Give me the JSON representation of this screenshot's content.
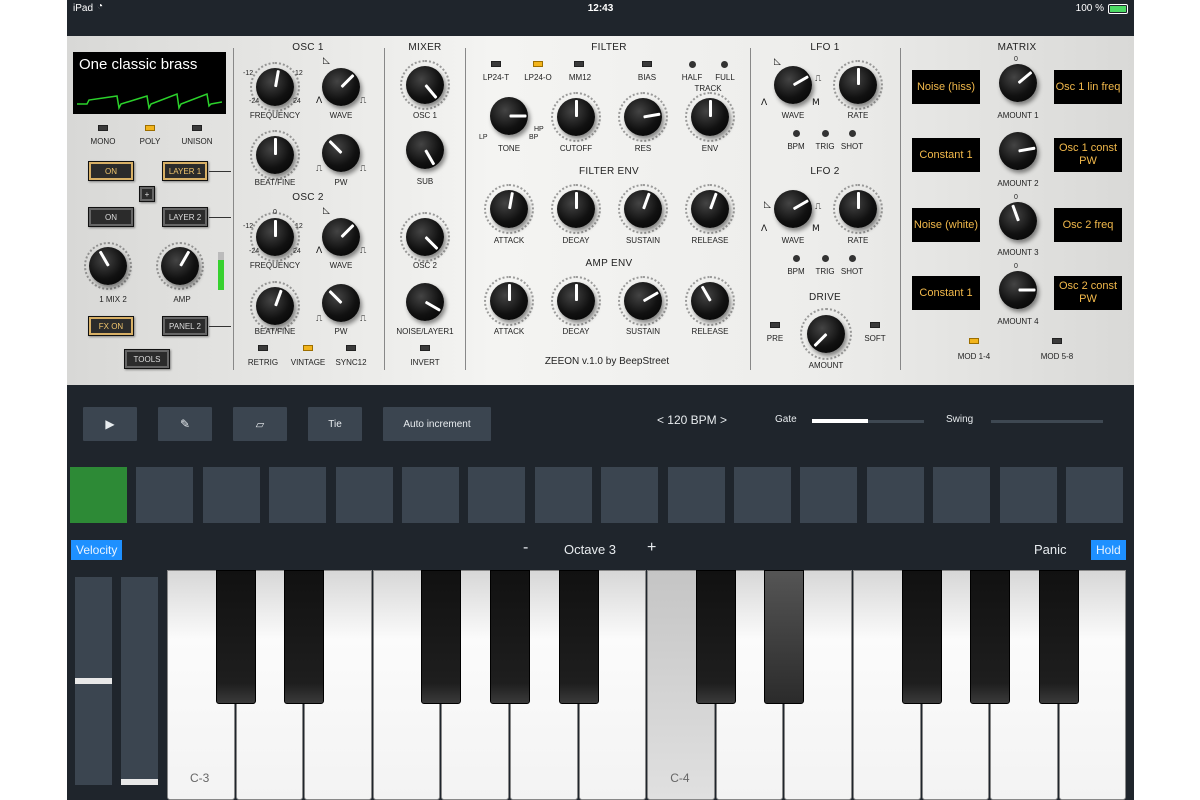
{
  "status": {
    "device": "iPad",
    "time": "12:43",
    "battery": "100 %"
  },
  "synth": {
    "display": {
      "preset_name": "One classic brass"
    },
    "voice_modes": [
      "MONO",
      "POLY",
      "UNISON"
    ],
    "layer_buttons": {
      "on1": "ON",
      "layer1": "LAYER 1",
      "plus": "+",
      "on2": "ON",
      "layer2": "LAYER 2",
      "fx_on": "FX ON",
      "panel2": "PANEL 2",
      "tools": "TOOLS"
    },
    "master": {
      "mix": "1 MIX 2",
      "amp": "AMP"
    },
    "osc1": {
      "title": "OSC 1",
      "freq_min": "-12",
      "freq_max": "12",
      "freq_min2": "-24",
      "freq_max2": "24",
      "frequency": "FREQUENCY",
      "wave": "WAVE",
      "beat": "BEAT/FINE",
      "pw": "PW"
    },
    "osc2": {
      "title": "OSC 2",
      "freq_min": "-12",
      "freq_max": "12",
      "freq_min2": "-24",
      "freq_max2": "24",
      "zero": "0",
      "frequency": "FREQUENCY",
      "wave": "WAVE",
      "beat": "BEAT/FINE",
      "pw": "PW"
    },
    "osc_switches": [
      "RETRIG",
      "VINTAGE",
      "SYNC12"
    ],
    "mixer": {
      "title": "MIXER",
      "osc1": "OSC 1",
      "sub": "SUB",
      "osc2": "OSC 2",
      "noise": "NOISE/LAYER1",
      "invert": "INVERT"
    },
    "filter": {
      "title": "FILTER",
      "modes": [
        "LP24-T",
        "LP24-O",
        "MM12"
      ],
      "bias": "BIAS",
      "half": "HALF",
      "full": "FULL",
      "track": "TRACK",
      "tone": "TONE",
      "cutoff": "CUTOFF",
      "res": "RES",
      "env": "ENV",
      "lp": "LP",
      "hp": "HP",
      "bp": "BP"
    },
    "filter_env": {
      "title": "FILTER ENV",
      "attack": "ATTACK",
      "decay": "DECAY",
      "sustain": "SUSTAIN",
      "release": "RELEASE"
    },
    "amp_env": {
      "title": "AMP ENV",
      "attack": "ATTACK",
      "decay": "DECAY",
      "sustain": "SUSTAIN",
      "release": "RELEASE"
    },
    "brand": "ZEEON v.1.0  by BeepStreet",
    "lfo1": {
      "title": "LFO 1",
      "wave": "WAVE",
      "rate": "RATE",
      "modes": [
        "BPM",
        "TRIG",
        "SHOT"
      ]
    },
    "lfo2": {
      "title": "LFO 2",
      "wave": "WAVE",
      "rate": "RATE",
      "modes": [
        "BPM",
        "TRIG",
        "SHOT"
      ]
    },
    "drive": {
      "title": "DRIVE",
      "pre": "PRE",
      "soft": "SOFT",
      "amount": "AMOUNT"
    },
    "matrix": {
      "title": "MATRIX",
      "rows": [
        {
          "source": "Noise (hiss)",
          "amount": "AMOUNT 1",
          "dest": "Osc 1 lin freq"
        },
        {
          "source": "Constant 1",
          "amount": "AMOUNT 2",
          "dest": "Osc 1 const PW"
        },
        {
          "source": "Noise (white)",
          "amount": "AMOUNT 3",
          "dest": "Osc 2 freq"
        },
        {
          "source": "Constant 1",
          "amount": "AMOUNT 4",
          "dest": "Osc 2 const PW"
        }
      ],
      "zero": "0",
      "pages": [
        "MOD 1-4",
        "MOD 5-8"
      ]
    },
    "colors": {
      "led_on": "#f2b41c",
      "mod_text": "#f2b94b",
      "panel": "#eeeeec"
    }
  },
  "sequencer": {
    "play_icon": "play-icon",
    "pencil_icon": "pencil-icon",
    "eraser_icon": "eraser-icon",
    "tie": "Tie",
    "auto_increment": "Auto increment",
    "bpm": "<  120 BPM  >",
    "gate_label": "Gate",
    "gate_value": 0.5,
    "swing_label": "Swing",
    "swing_value": 0.0,
    "steps_count": 16,
    "active_step": 1,
    "colors": {
      "active": "#2d8a36",
      "idle": "#3b4550"
    }
  },
  "keyboard": {
    "velocity": "Velocity",
    "octave_minus": "-",
    "octave": "Octave 3",
    "octave_plus": "+",
    "panic": "Panic",
    "hold": "Hold",
    "key_labels": {
      "c3": "C-3",
      "c4": "C-4"
    },
    "pitch_strip_value": 0.5,
    "mod_strip_value": 0.0
  }
}
